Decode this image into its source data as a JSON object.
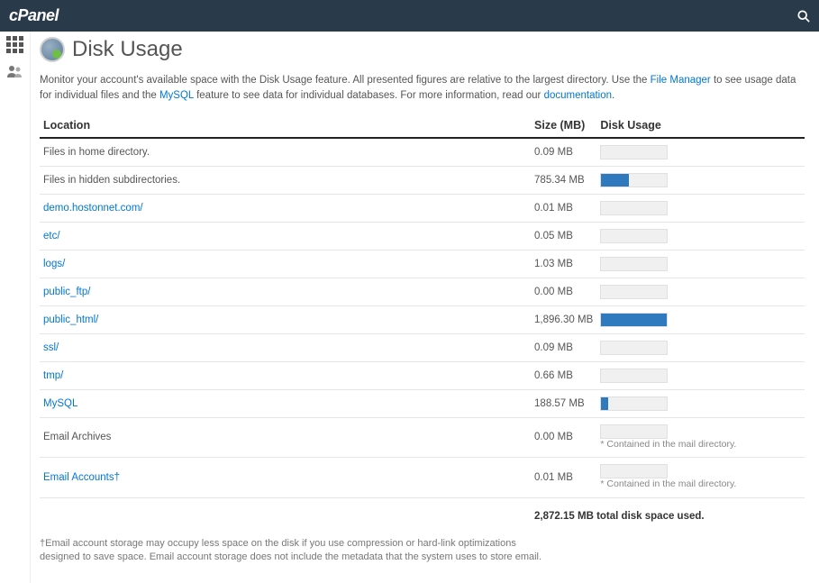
{
  "header": {
    "brand": "cPanel"
  },
  "page": {
    "title": "Disk Usage",
    "intro_pre": "Monitor your account's available space with the Disk Usage feature. All presented figures are relative to the largest directory. Use the ",
    "intro_link1": "File Manager",
    "intro_mid": " to see usage data for individual files and the ",
    "intro_link2": "MySQL",
    "intro_post": " feature to see data for individual databases. For more information, read our ",
    "intro_doc": "documentation",
    "intro_end": "."
  },
  "table": {
    "headers": {
      "location": "Location",
      "size": "Size (MB)",
      "usage": "Disk Usage"
    },
    "max_value": 1896.3,
    "rows": [
      {
        "label": "Files in home directory.",
        "link": false,
        "size": "0.09 MB",
        "bar": 0.09,
        "note": ""
      },
      {
        "label": "Files in hidden subdirectories.",
        "link": false,
        "size": "785.34 MB",
        "bar": 785.34,
        "note": ""
      },
      {
        "label": "demo.hostonnet.com/",
        "link": true,
        "size": "0.01 MB",
        "bar": 0.01,
        "note": ""
      },
      {
        "label": "etc/",
        "link": true,
        "size": "0.05 MB",
        "bar": 0.05,
        "note": ""
      },
      {
        "label": "logs/",
        "link": true,
        "size": "1.03 MB",
        "bar": 1.03,
        "note": ""
      },
      {
        "label": "public_ftp/",
        "link": true,
        "size": "0.00 MB",
        "bar": 0.0,
        "note": ""
      },
      {
        "label": "public_html/",
        "link": true,
        "size": "1,896.30 MB",
        "bar": 1896.3,
        "note": ""
      },
      {
        "label": "ssl/",
        "link": true,
        "size": "0.09 MB",
        "bar": 0.09,
        "note": ""
      },
      {
        "label": "tmp/",
        "link": true,
        "size": "0.66 MB",
        "bar": 0.66,
        "note": ""
      },
      {
        "label": "MySQL",
        "link": true,
        "size": "188.57 MB",
        "bar": 188.57,
        "note": ""
      },
      {
        "label": "Email Archives",
        "link": false,
        "size": "0.00 MB",
        "bar": null,
        "note": "* Contained in the mail directory."
      },
      {
        "label": "Email Accounts†",
        "link": true,
        "size": "0.01 MB",
        "bar": null,
        "note": "* Contained in the mail directory."
      }
    ],
    "total": "2,872.15 MB total disk space used."
  },
  "footnote": "†Email account storage may occupy less space on the disk if you use compression or hard-link optimizations designed to save space. Email account storage does not include the metadata that the system uses to store email."
}
